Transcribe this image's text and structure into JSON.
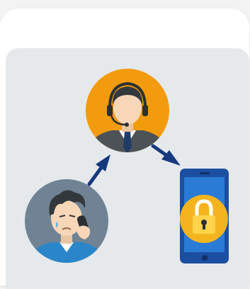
{
  "card": {
    "header_text": ""
  },
  "illustration": {
    "nodes": [
      {
        "id": "support-agent",
        "icon": "headset-agent-icon",
        "color": "#f29b0c"
      },
      {
        "id": "worried-caller",
        "icon": "phone-caller-icon",
        "color": "#6f8394"
      },
      {
        "id": "secured-phone",
        "icon": "locked-smartphone-icon",
        "color": "#1c4ea1"
      }
    ],
    "colors": {
      "panel_bg": "#e5e9ec",
      "arrow": "#17387d",
      "skin": "#f7d7b8",
      "lock": "#f5b41e"
    }
  }
}
